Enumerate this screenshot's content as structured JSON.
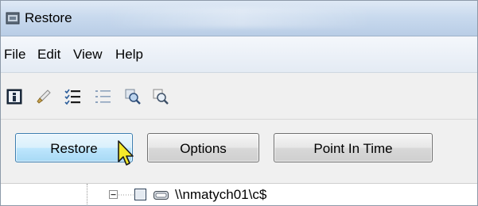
{
  "window": {
    "title": "Restore",
    "icon": "restore-app-icon"
  },
  "menu": {
    "items": [
      "File",
      "Edit",
      "View",
      "Help"
    ]
  },
  "toolbar": {
    "icons": [
      "info-icon",
      "clear-brush-icon",
      "checklist-icon",
      "list-icon",
      "search-zoom-icon",
      "find-icon"
    ]
  },
  "actions": {
    "restore_label": "Restore",
    "options_label": "Options",
    "point_in_time_label": "Point In Time"
  },
  "tree": {
    "item_label": "\\\\nmatych01\\c$",
    "expanded": true,
    "checked": false
  },
  "colors": {
    "titlebar": "#c9daee",
    "button_hover": "#bee6fd",
    "cursor": "#f6e92a"
  }
}
